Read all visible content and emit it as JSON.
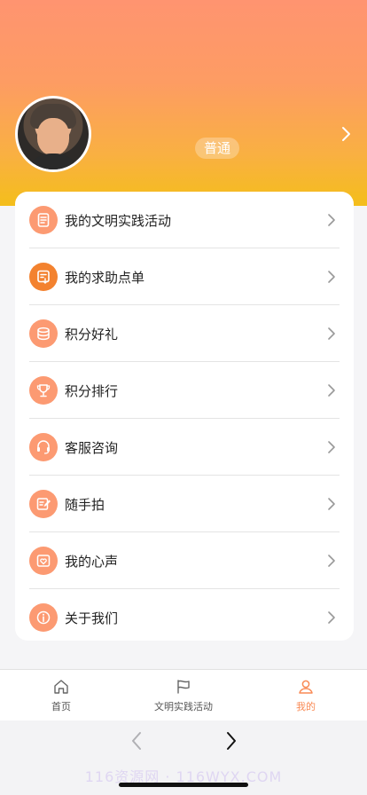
{
  "profile": {
    "level": "普通"
  },
  "menu": {
    "items": [
      {
        "label": "我的文明实践活动",
        "icon": "document-icon",
        "style": "light"
      },
      {
        "label": "我的求助点单",
        "icon": "request-order-icon",
        "style": "dark"
      },
      {
        "label": "积分好礼",
        "icon": "coins-stack-icon",
        "style": "light"
      },
      {
        "label": "积分排行",
        "icon": "trophy-icon",
        "style": "light"
      },
      {
        "label": "客服咨询",
        "icon": "headset-icon",
        "style": "light"
      },
      {
        "label": "随手拍",
        "icon": "edit-note-icon",
        "style": "light"
      },
      {
        "label": "我的心声",
        "icon": "heart-message-icon",
        "style": "light"
      },
      {
        "label": "关于我们",
        "icon": "info-icon",
        "style": "light"
      }
    ]
  },
  "tabbar": {
    "tabs": [
      {
        "label": "首页",
        "icon": "home-icon",
        "active": false
      },
      {
        "label": "文明实践活动",
        "icon": "flag-icon",
        "active": false
      },
      {
        "label": "我的",
        "icon": "user-icon",
        "active": true
      }
    ]
  },
  "browser": {
    "watermark": "116资源网 · 116WYX.COM"
  },
  "colors": {
    "accent": "#f98a55",
    "icon_bg": "#fc9a72",
    "icon_bg_dark": "#f3822f",
    "header_top": "#ff9470",
    "header_bottom": "#f4be1b"
  }
}
